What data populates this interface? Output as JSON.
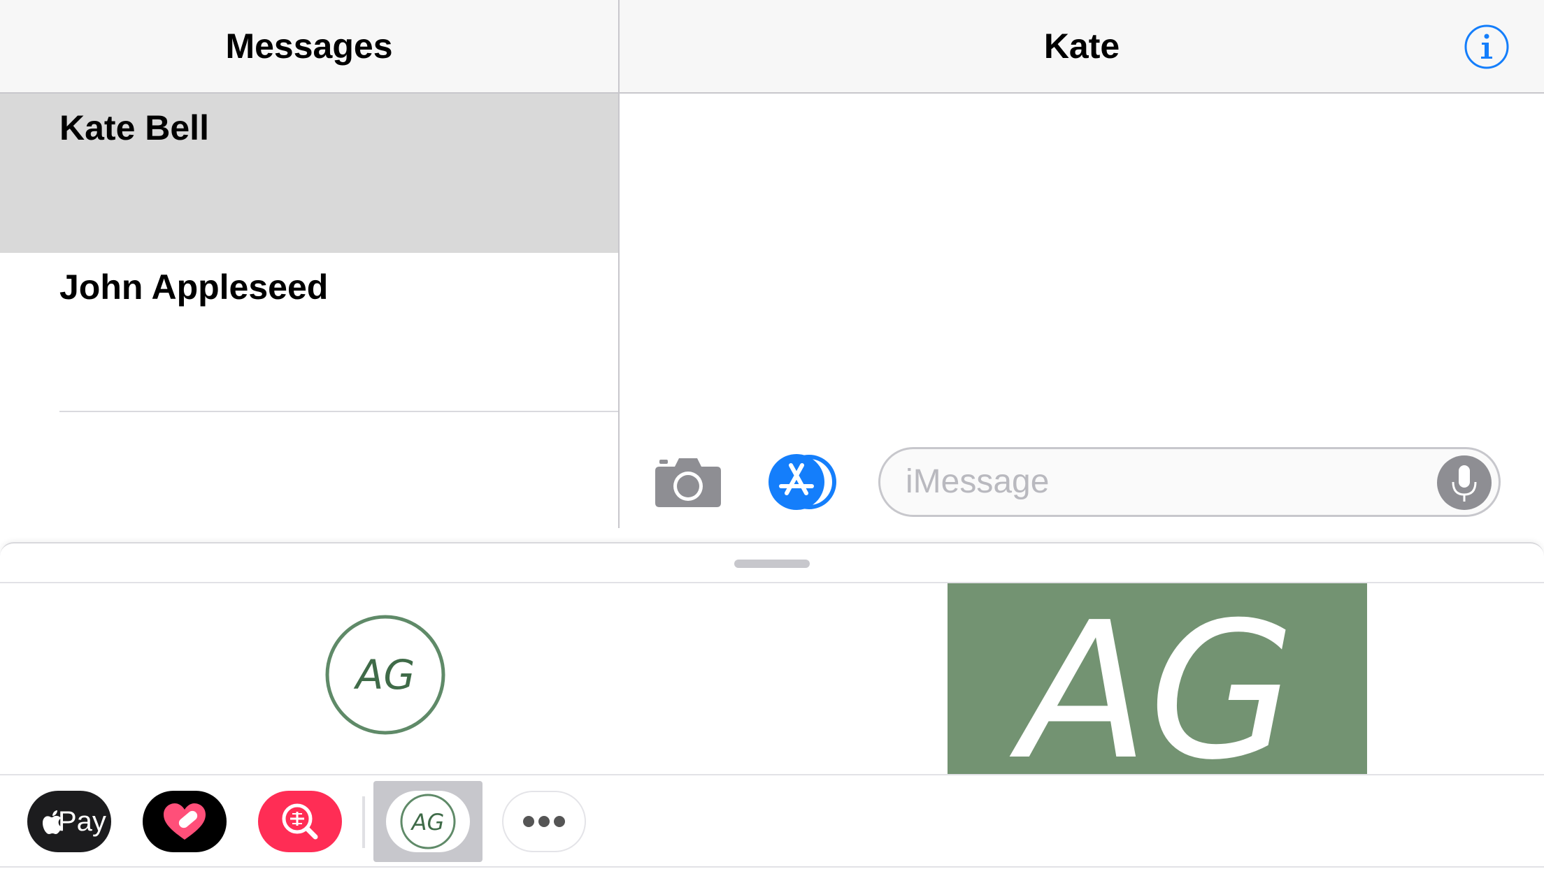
{
  "master": {
    "title": "Messages",
    "conversations": [
      {
        "name": "Kate Bell",
        "selected": true
      },
      {
        "name": "John Appleseed",
        "selected": false
      }
    ]
  },
  "detail": {
    "title": "Kate",
    "info_icon": "info-circle-icon"
  },
  "compose": {
    "placeholder": "iMessage",
    "camera_icon": "camera-icon",
    "appstore_icon": "app-store-icon",
    "mic_icon": "microphone-icon"
  },
  "drawer": {
    "sticker_small_text": "AG",
    "sticker_large_text": "AG"
  },
  "app_strip": {
    "apple_pay_label": "Pay",
    "apps": [
      "apple-pay",
      "heart-app",
      "search-app",
      "ag-app",
      "more"
    ],
    "ag_label": "AG"
  },
  "colors": {
    "accent": "#147efb",
    "selected_row": "#d9d9d9",
    "sticker_green": "#739372",
    "sticker_outline": "#5f8a68",
    "search_app_bg": "#ff2d55",
    "mic_bg": "#8e8e93"
  }
}
